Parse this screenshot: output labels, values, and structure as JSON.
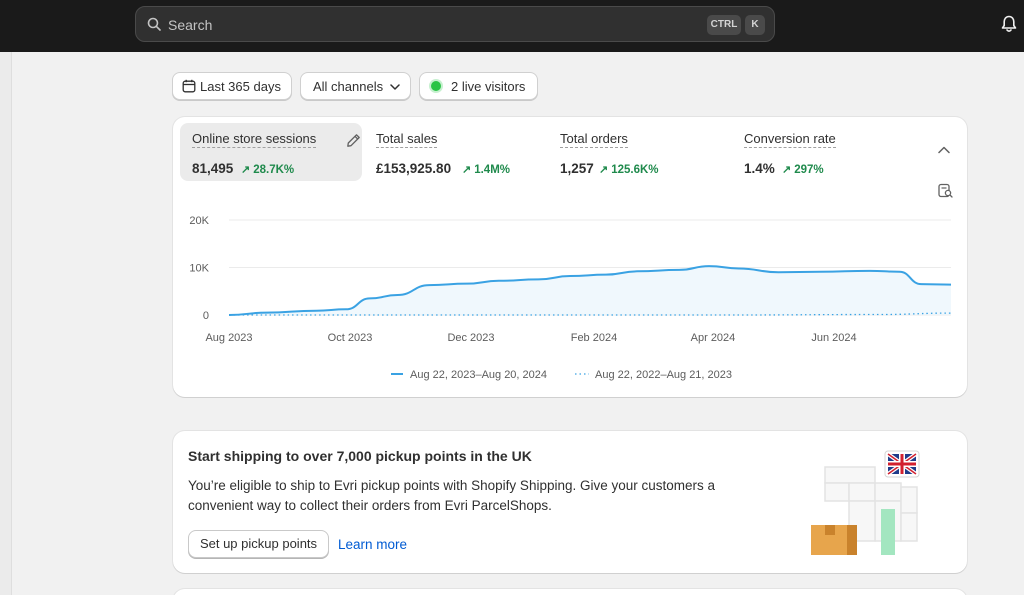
{
  "topbar": {
    "search_placeholder": "Search",
    "shortcut_ctrl": "CTRL",
    "shortcut_k": "K"
  },
  "filters": {
    "date_range": "Last 365 days",
    "channels": "All channels",
    "live_visitors": "2 live visitors"
  },
  "metrics": [
    {
      "label": "Online store sessions",
      "value": "81,495",
      "delta": "28.7K%"
    },
    {
      "label": "Total sales",
      "value": "£153,925.80",
      "delta": "1.4M%"
    },
    {
      "label": "Total orders",
      "value": "1,257",
      "delta": "125.6K%"
    },
    {
      "label": "Conversion rate",
      "value": "1.4%",
      "delta": "297%"
    }
  ],
  "colors": {
    "accent": "#3aa2e3",
    "positive": "#1f8a4c",
    "live": "#29c445",
    "link": "#005bd3"
  },
  "chart_data": {
    "type": "line",
    "yticks": [
      "20K",
      "10K",
      "0"
    ],
    "ylim": [
      0,
      20000
    ],
    "xticks": [
      "Aug 2023",
      "Oct 2023",
      "Dec 2023",
      "Feb 2024",
      "Apr 2024",
      "Jun 2024"
    ],
    "series": [
      {
        "name": "Aug 22, 2023–Aug 20, 2024",
        "style": "solid",
        "color": "#3aa2e3",
        "x": [
          "2023-08-22",
          "2023-09-10",
          "2023-10-05",
          "2023-10-20",
          "2023-11-01",
          "2023-11-15",
          "2023-12-01",
          "2023-12-20",
          "2024-01-05",
          "2024-01-25",
          "2024-02-10",
          "2024-02-28",
          "2024-03-15",
          "2024-04-05",
          "2024-04-20",
          "2024-05-05",
          "2024-05-25",
          "2024-06-15",
          "2024-07-10",
          "2024-07-25",
          "2024-08-05",
          "2024-08-20"
        ],
        "values": [
          0,
          500,
          900,
          1200,
          3500,
          4200,
          6300,
          6600,
          7200,
          7500,
          8200,
          8500,
          9200,
          9500,
          10300,
          9800,
          9000,
          9100,
          9300,
          9100,
          6500,
          6400
        ]
      },
      {
        "name": "Aug 22, 2022–Aug 21, 2023",
        "style": "dotted",
        "color": "#3aa2e3",
        "x": [
          "2023-08-22",
          "2024-05-01",
          "2024-07-15",
          "2024-08-20"
        ],
        "values": [
          0,
          0,
          100,
          400
        ]
      }
    ]
  },
  "promo": {
    "title": "Start shipping to over 7,000 pickup points in the UK",
    "body": "You’re eligible to ship to Evri pickup points with Shopify Shipping. Give your customers a convenient way to collect their orders from Evri ParcelShops.",
    "primary_button": "Set up pickup points",
    "link": "Learn more"
  }
}
